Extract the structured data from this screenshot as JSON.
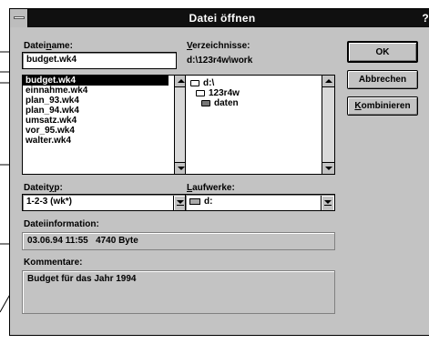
{
  "window": {
    "title": "Datei öffnen",
    "help_glyph": "?"
  },
  "filename": {
    "label_prefix": "Datei",
    "label_accel": "n",
    "label_suffix": "ame:",
    "value": "budget.wk4"
  },
  "files": [
    "budget.wk4",
    "einnahme.wk4",
    "plan_93.wk4",
    "plan_94.wk4",
    "umsatz.wk4",
    "vor_95.wk4",
    "walter.wk4"
  ],
  "directories": {
    "label_accel": "V",
    "label_suffix": "erzeichnisse:",
    "current_path": "d:\\123r4w\\work",
    "items": [
      {
        "name": "d:\\",
        "icon": "open-folder-icon"
      },
      {
        "name": "123r4w",
        "icon": "open-folder-icon"
      },
      {
        "name": "daten",
        "icon": "closed-folder-icon"
      }
    ]
  },
  "buttons": {
    "ok": "OK",
    "cancel": "Abbrechen",
    "combine_accel": "K",
    "combine_rest": "ombinieren"
  },
  "filetype": {
    "label_prefix": "Dateit",
    "label_accel": "y",
    "label_suffix": "p:",
    "value": "1-2-3 (wk*)"
  },
  "drives": {
    "label_accel": "L",
    "label_suffix": "aufwerke:",
    "value": "d:",
    "icon": "hard-drive-icon"
  },
  "fileinfo": {
    "label": "Dateiinformation:",
    "value": "03.06.94 11:55   4740 Byte"
  },
  "comments": {
    "label": "Kommentare:",
    "value": "Budget für das Jahr 1994"
  },
  "colors": {
    "dialog_bg": "#c3c3c3",
    "titlebar": "#101010",
    "selection": "#000000"
  }
}
